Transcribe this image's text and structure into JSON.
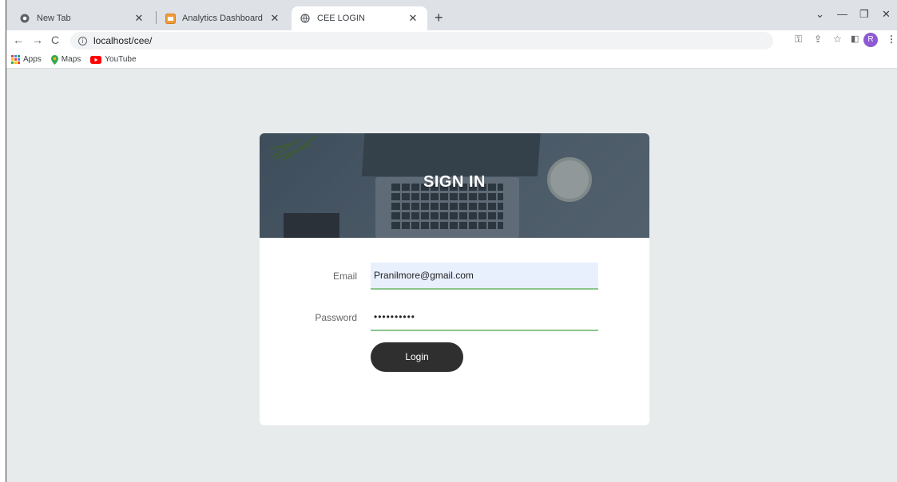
{
  "browser": {
    "tabs": [
      {
        "title": "New Tab",
        "icon": "chrome-icon"
      },
      {
        "title": "Analytics Dashboard - This is an",
        "icon": "dashboard-favicon"
      },
      {
        "title": "CEE LOGIN",
        "icon": "globe-icon"
      }
    ],
    "active_tab": 2,
    "url": "localhost/cee/",
    "bookmarks": [
      {
        "label": "Apps",
        "icon": "apps-grid-icon"
      },
      {
        "label": "Maps",
        "icon": "maps-pin-icon"
      },
      {
        "label": "YouTube",
        "icon": "youtube-icon"
      }
    ],
    "profile_initial": "R"
  },
  "login": {
    "heading": "SIGN IN",
    "email_label": "Email",
    "email_value": "Pranilmore@gmail.com",
    "password_label": "Password",
    "password_value": "••••••••••",
    "login_button": "Login"
  },
  "colors": {
    "page_bg": "#e8ebec",
    "button_bg": "#2f2f2f",
    "input_underline": "#8bc58b",
    "autofill_bg": "#e8f0fe"
  }
}
